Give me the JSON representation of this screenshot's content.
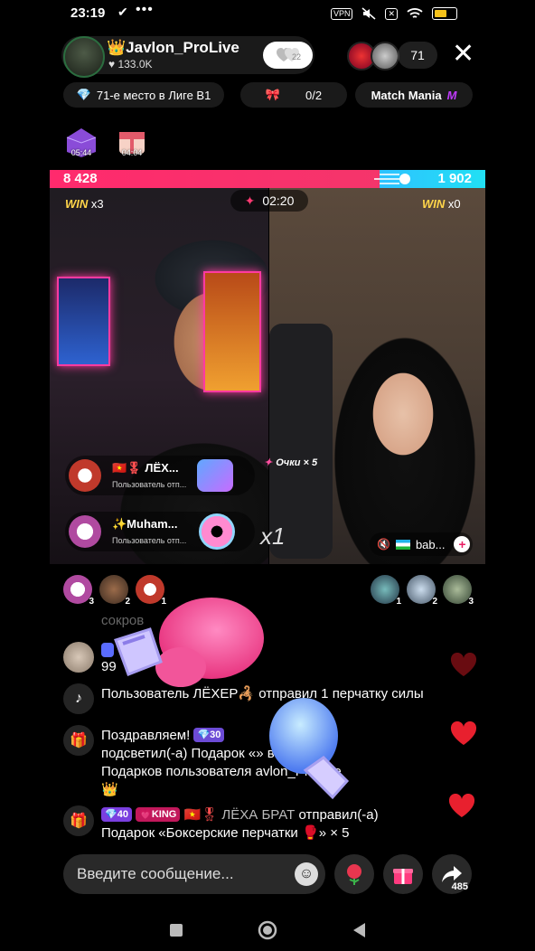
{
  "status_bar": {
    "time": "23:19",
    "check_glyph": "✔",
    "dots": "•••",
    "vpn_label": "VPN",
    "battery_level": 0.5
  },
  "host": {
    "name": "👑Javlon_ProLive",
    "likes": "♥ 133.0K",
    "follow_count": "22"
  },
  "viewers": {
    "count": "71"
  },
  "chips": {
    "league": "71-е место в Лиге B1",
    "progress": "0/2",
    "match": "Match Mania"
  },
  "gift_timers": [
    "05:44",
    "04:04"
  ],
  "battle": {
    "left_score": "8 428",
    "right_score": "1 902",
    "timer": "02:20",
    "left_win_label": "WIN",
    "left_win_count": "x3",
    "right_win_label": "WIN",
    "right_win_count": "x0"
  },
  "gifters": [
    {
      "name": "ЛЁХ...",
      "sub": "Пользователь отп..."
    },
    {
      "name": "✨Muham...",
      "sub": "Пользователь отп..."
    }
  ],
  "multiplier": "x1",
  "points_tag": "Очки × 5",
  "guest": {
    "name": "bab..."
  },
  "left_ranks": [
    "3",
    "2",
    "1"
  ],
  "right_ranks": [
    "1",
    "2",
    "3"
  ],
  "chat": {
    "faded": "сокров",
    "user_msg": "99",
    "sys1": "Пользователь ЛЁХЕР🦂 отправил 1 перчатку силы",
    "sys2_line1_a": "Поздравляем!",
    "sys2_badge": "30",
    "sys2_line2": "подсветил(-а) Подарок «",
    "sys2_line2_b": "» в Галерее",
    "sys2_line3": "Подарков пользователя",
    "sys2_line3_b": "avlon_ProLive",
    "sys2_crown": "👑",
    "sys3_level": "40",
    "sys3_king": "KING",
    "sys3_name": "ЛЁХА БРАТ",
    "sys3_action": "отправил(-а)",
    "sys3_line2": "Подарок «Боксерские перчатки",
    "sys3_count": "» × 5"
  },
  "composer": {
    "placeholder": "Введите сообщение...",
    "share_count": "485"
  },
  "colors": {
    "left_team": "#ff2a6d",
    "right_team": "#21e0f4",
    "heart": "#e8202e"
  },
  "icons": [
    "diamond-icon",
    "lightning-icon",
    "gift-icon",
    "tiktok-icon",
    "rose-icon",
    "share-icon",
    "emoji-icon",
    "boxing-glove-icon"
  ]
}
